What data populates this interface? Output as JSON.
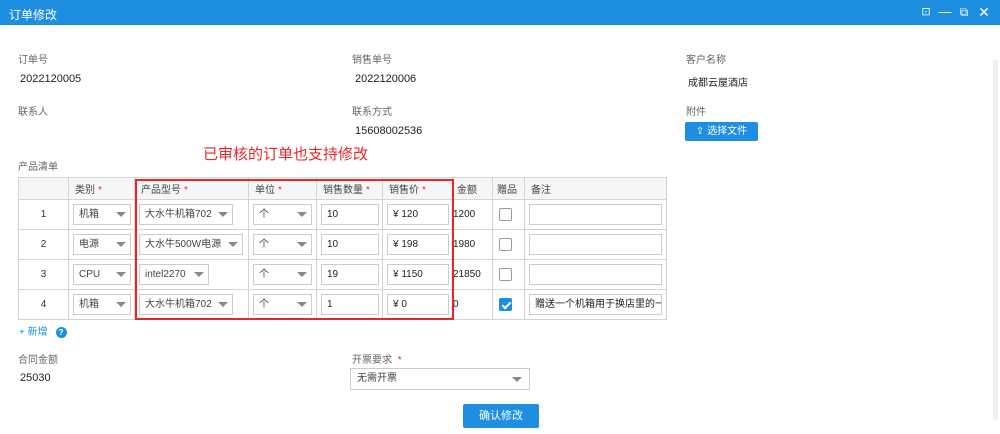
{
  "window": {
    "title": "订单修改"
  },
  "fields": {
    "order_no_label": "订单号",
    "order_no": "2022120005",
    "sales_no_label": "销售单号",
    "sales_no": "2022120006",
    "customer_label": "客户名称",
    "customer": "成都云屋酒店",
    "contact_label": "联系人",
    "contact": "",
    "phone_label": "联系方式",
    "phone": "15608002536",
    "attach_label": "附件",
    "attach_button": "⇪ 选择文件"
  },
  "annotation": "已审核的订单也支持修改",
  "products": {
    "section_label": "产品清单",
    "columns": [
      "",
      "类别",
      "产品型号",
      "单位",
      "销售数量",
      "销售价",
      "金额",
      "赠品",
      "备注"
    ],
    "required_mark": "*",
    "rows": [
      {
        "no": "1",
        "category": "机箱",
        "model": "大水牛机箱702",
        "unit": "个",
        "qty": "10",
        "price": "120",
        "amount": "1200",
        "gift": false,
        "note": ""
      },
      {
        "no": "2",
        "category": "电源",
        "model": "大水牛500W电源",
        "unit": "个",
        "qty": "10",
        "price": "198",
        "amount": "1980",
        "gift": false,
        "note": ""
      },
      {
        "no": "3",
        "category": "CPU",
        "model": "intel2270",
        "unit": "个",
        "qty": "19",
        "price": "1150",
        "amount": "21850",
        "gift": false,
        "note": ""
      },
      {
        "no": "4",
        "category": "机箱",
        "model": "大水牛机箱702",
        "unit": "个",
        "qty": "1",
        "price": "0",
        "amount": "0",
        "gift": true,
        "note": "赠送一个机箱用于换店里的一"
      }
    ],
    "currency": "¥",
    "add_label": "+ 新增",
    "help_icon": "?"
  },
  "contract": {
    "label": "合同金额",
    "value": "25030"
  },
  "invoice": {
    "label": "开票要求",
    "required_mark": "*",
    "value": "无需开票"
  },
  "confirm_button": "确认修改"
}
